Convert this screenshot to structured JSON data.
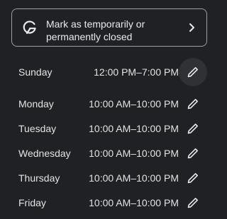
{
  "notice": {
    "text_line1": "Mark as temporarily or",
    "text_line2": "permanently closed",
    "icon": "google-g-icon",
    "chevron_icon": "chevron-right-icon"
  },
  "hours": [
    {
      "day": "Sunday",
      "time": "12:00 PM–7:00 PM",
      "edit_icon": "pencil-icon"
    },
    {
      "day": "Monday",
      "time": "10:00 AM–10:00 PM",
      "edit_icon": "pencil-icon"
    },
    {
      "day": "Tuesday",
      "time": "10:00 AM–10:00 PM",
      "edit_icon": "pencil-icon"
    },
    {
      "day": "Wednesday",
      "time": "10:00 AM–10:00 PM",
      "edit_icon": "pencil-icon"
    },
    {
      "day": "Thursday",
      "time": "10:00 AM–10:00 PM",
      "edit_icon": "pencil-icon"
    },
    {
      "day": "Friday",
      "time": "10:00 AM–10:00 PM",
      "edit_icon": "pencil-icon"
    }
  ],
  "colors": {
    "background": "#202124",
    "text": "#e3e3e3",
    "border": "#9aa0a6"
  }
}
